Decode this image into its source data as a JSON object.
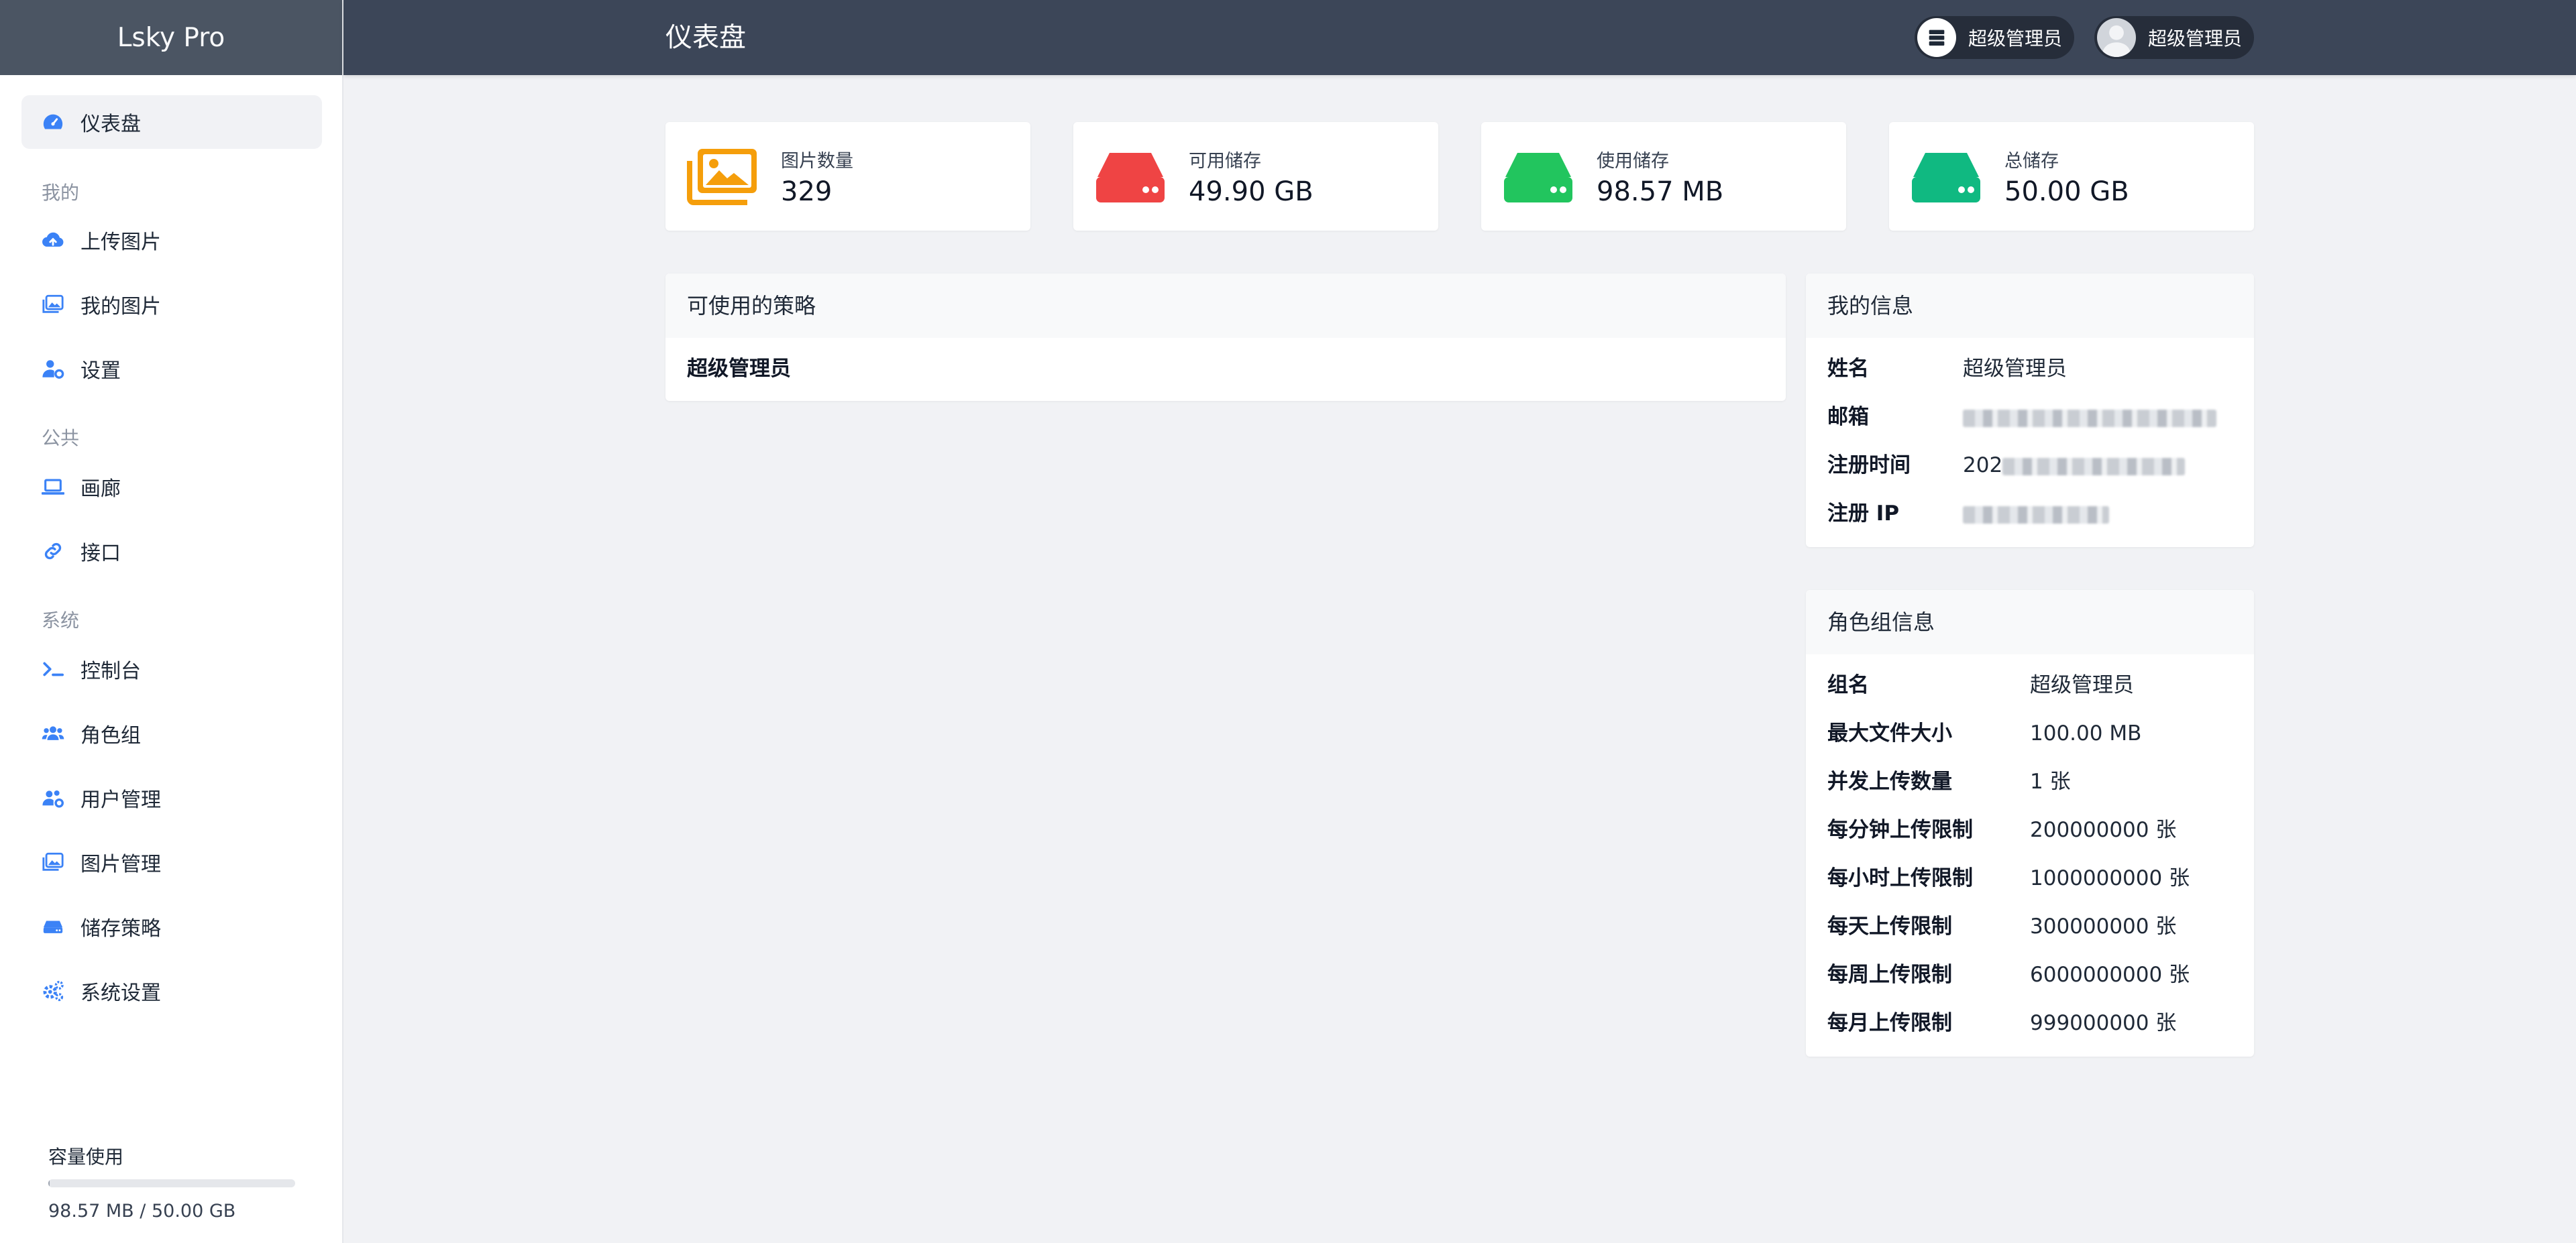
{
  "app": {
    "brand": "Lsky Pro",
    "page_title": "仪表盘"
  },
  "header": {
    "pill1_label": "超级管理员",
    "pill2_label": "超级管理员"
  },
  "sidebar": {
    "dashboard": "仪表盘",
    "section_mine": "我的",
    "upload": "上传图片",
    "my_images": "我的图片",
    "settings": "设置",
    "section_public": "公共",
    "gallery": "画廊",
    "api": "接口",
    "section_system": "系统",
    "console": "控制台",
    "roles": "角色组",
    "users": "用户管理",
    "images": "图片管理",
    "strategies": "储存策略",
    "system_settings": "系统设置",
    "usage_title": "容量使用",
    "usage_text": "98.57 MB / 50.00 GB",
    "usage_fraction": 0.002
  },
  "stats": [
    {
      "label": "图片数量",
      "value": "329",
      "icon": "images-icon",
      "color": "#f59e0b"
    },
    {
      "label": "可用储存",
      "value": "49.90 GB",
      "icon": "hdd-icon",
      "color": "#ef4444"
    },
    {
      "label": "使用储存",
      "value": "98.57 MB",
      "icon": "hdd-icon",
      "color": "#22c55e"
    },
    {
      "label": "总储存",
      "value": "50.00 GB",
      "icon": "hdd-icon",
      "color": "#10b981"
    }
  ],
  "strategies_panel": {
    "title": "可使用的策略",
    "item": "超级管理员"
  },
  "my_info": {
    "title": "我的信息",
    "name_label": "姓名",
    "name_value": "超级管理员",
    "email_label": "邮箱",
    "reg_time_label": "注册时间",
    "reg_time_prefix": "202",
    "reg_ip_label": "注册 IP"
  },
  "role_info": {
    "title": "角色组信息",
    "rows": [
      {
        "label": "组名",
        "value": "超级管理员"
      },
      {
        "label": "最大文件大小",
        "value": "100.00 MB"
      },
      {
        "label": "并发上传数量",
        "value": "1 张"
      },
      {
        "label": "每分钟上传限制",
        "value": "200000000 张"
      },
      {
        "label": "每小时上传限制",
        "value": "1000000000 张"
      },
      {
        "label": "每天上传限制",
        "value": "300000000 张"
      },
      {
        "label": "每周上传限制",
        "value": "6000000000 张"
      },
      {
        "label": "每月上传限制",
        "value": "999000000 张"
      }
    ]
  }
}
